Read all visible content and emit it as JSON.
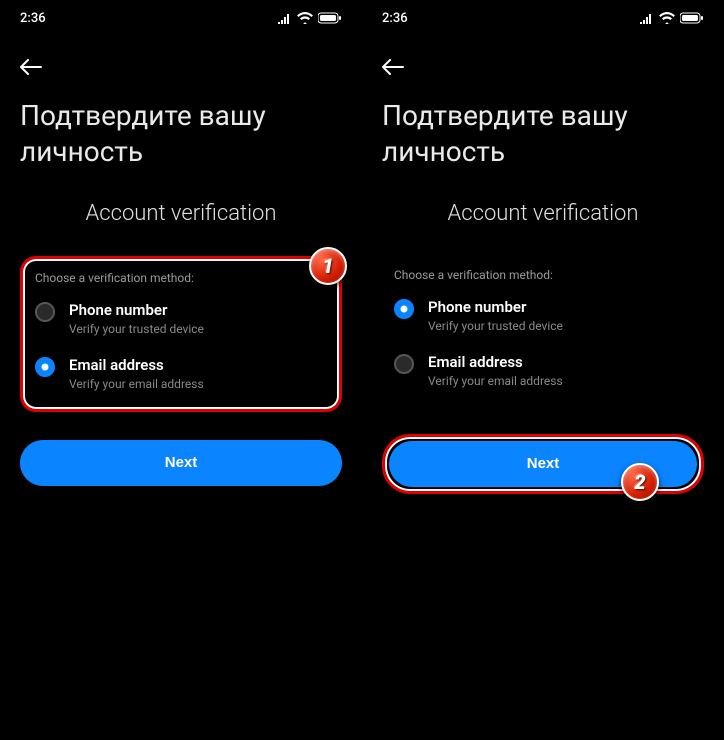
{
  "status": {
    "time": "2:36"
  },
  "screen": {
    "title": "Подтвердите вашу личность",
    "subtitle": "Account verification",
    "method_label": "Choose a verification method:",
    "options": {
      "phone": {
        "title": "Phone number",
        "desc": "Verify your trusted device"
      },
      "email": {
        "title": "Email address",
        "desc": "Verify your email address"
      }
    },
    "next_label": "Next"
  },
  "badges": {
    "one": "1",
    "two": "2"
  },
  "colors": {
    "accent": "#0a84ff",
    "highlight": "#e00000",
    "background": "#000000"
  }
}
